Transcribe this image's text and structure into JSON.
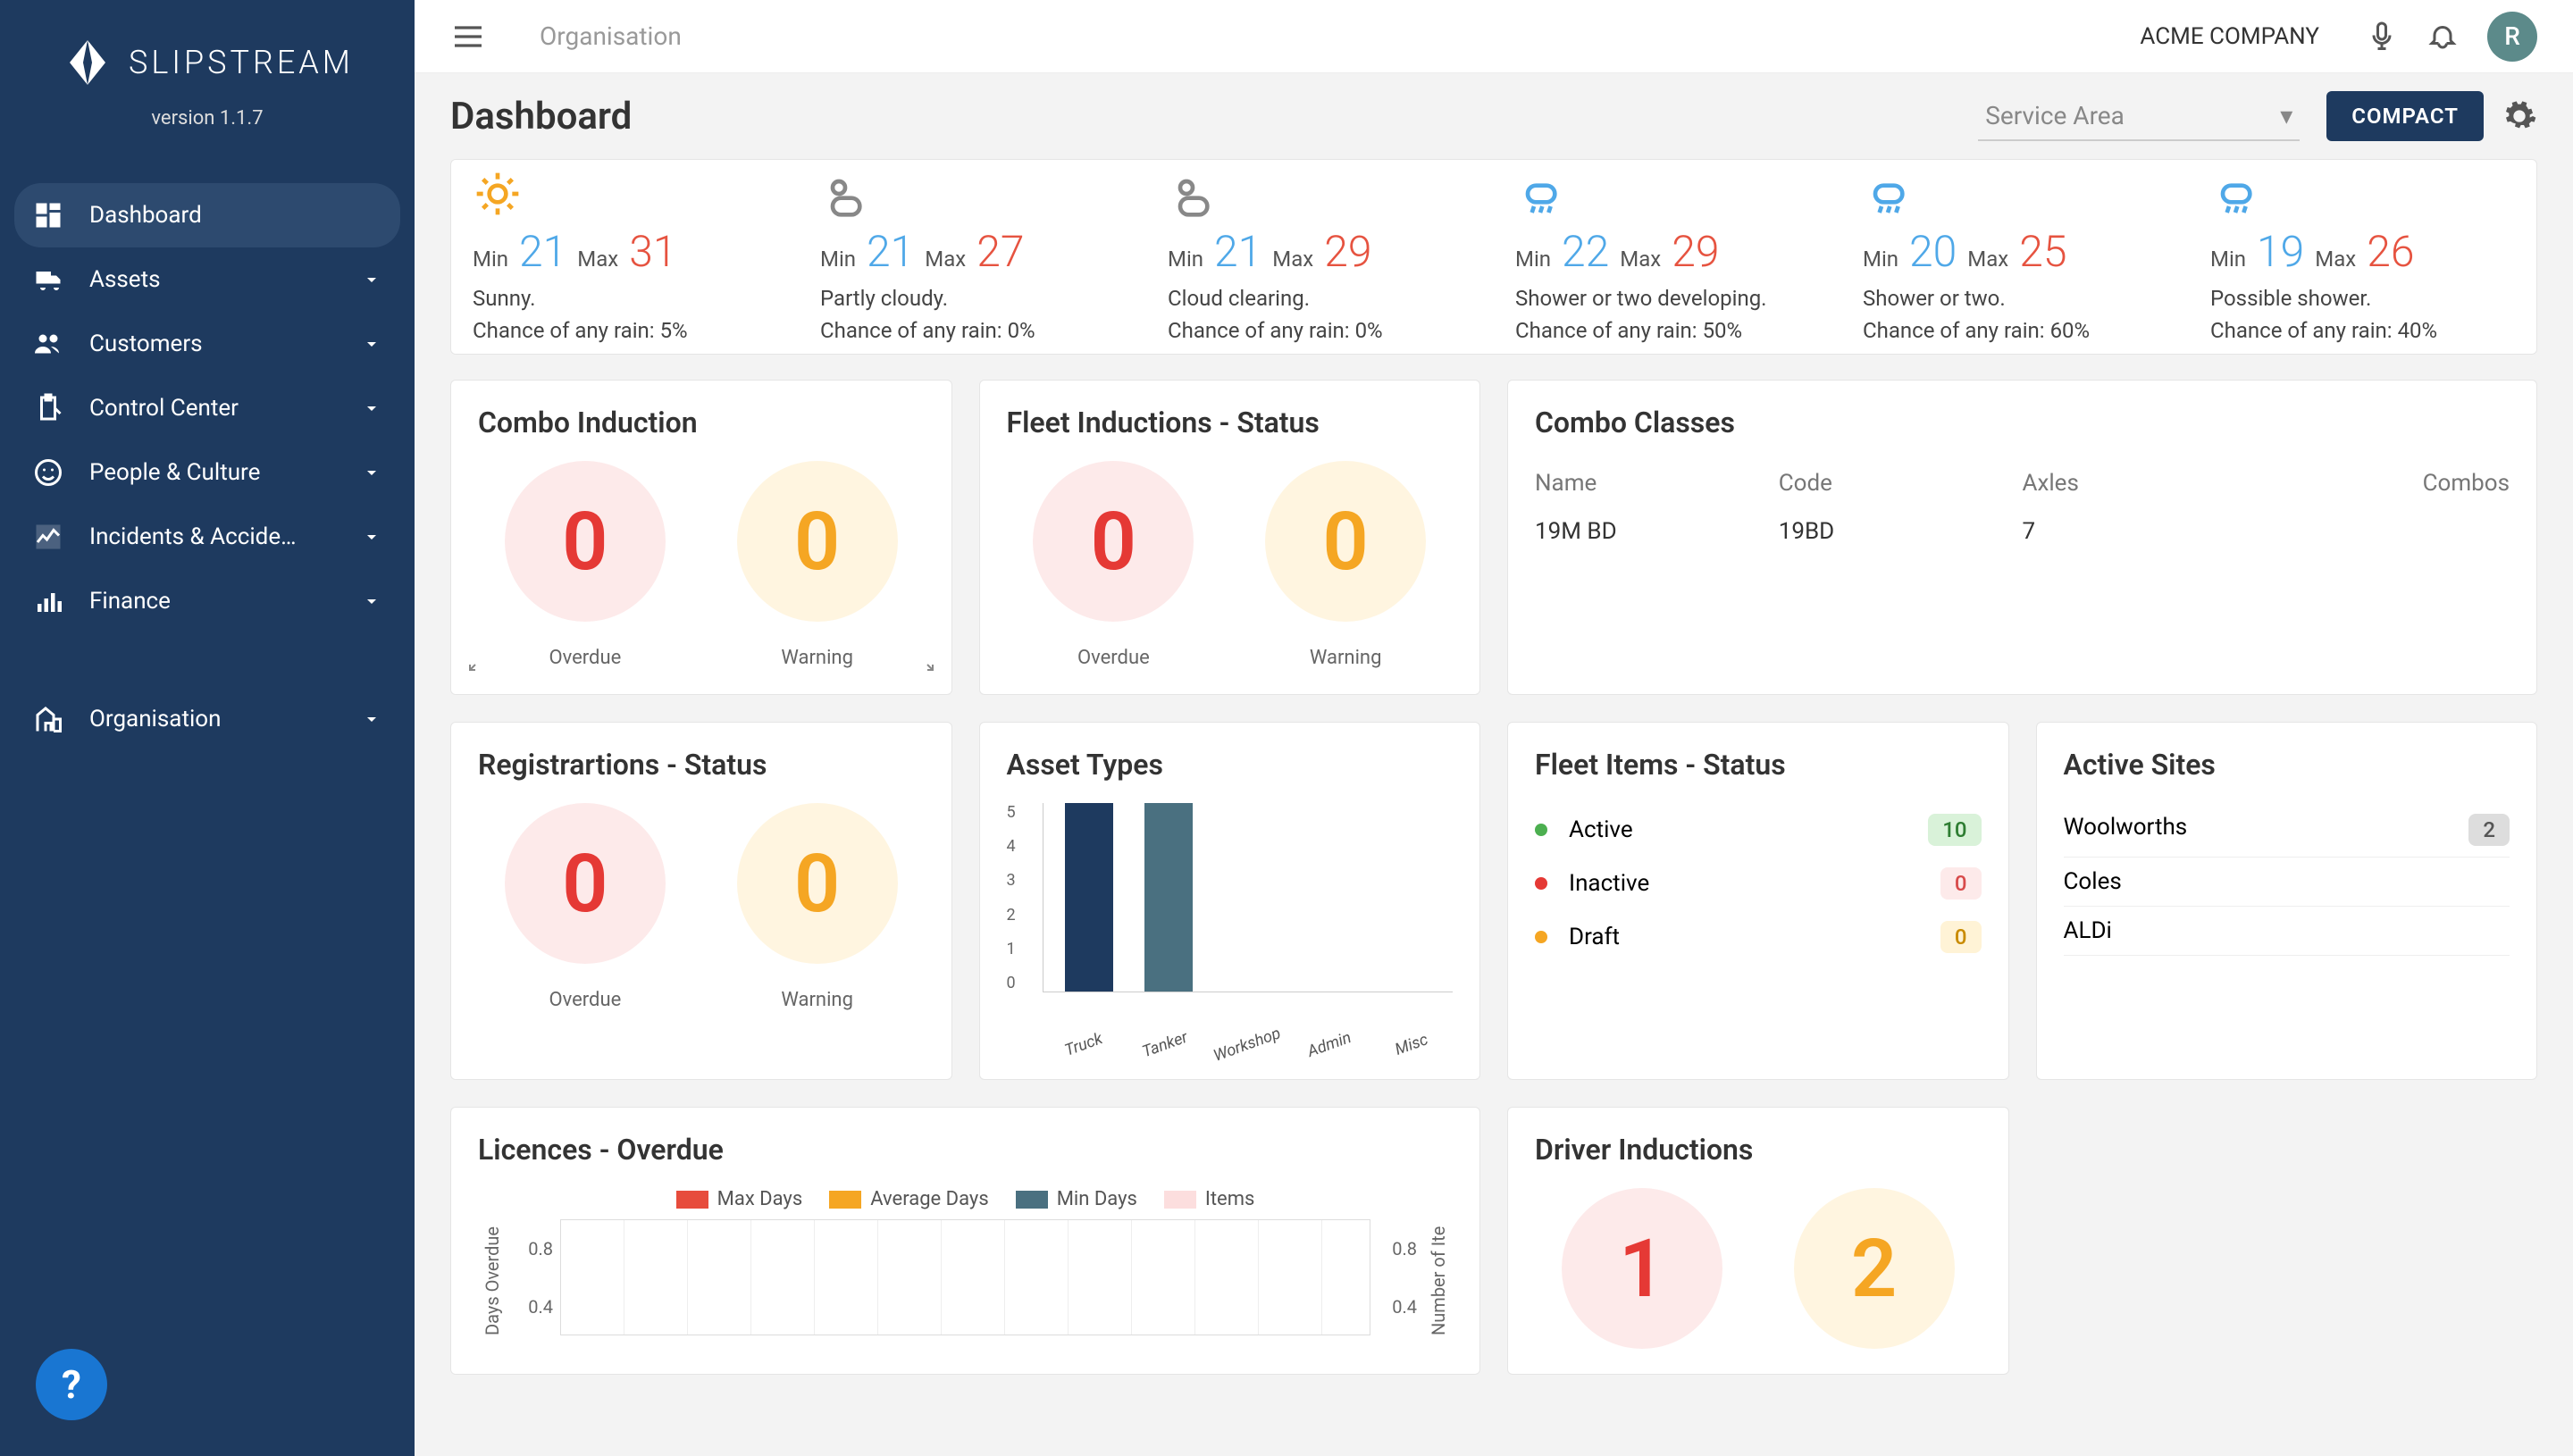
{
  "app": {
    "name": "SLIPSTREAM",
    "version": "version 1.1.7"
  },
  "sidebar": {
    "items": [
      {
        "label": "Dashboard",
        "icon": "dashboard-icon",
        "active": true,
        "expandable": false
      },
      {
        "label": "Assets",
        "icon": "truck-icon",
        "active": false,
        "expandable": true
      },
      {
        "label": "Customers",
        "icon": "people-icon",
        "active": false,
        "expandable": true
      },
      {
        "label": "Control Center",
        "icon": "clipboard-icon",
        "active": false,
        "expandable": true
      },
      {
        "label": "People & Culture",
        "icon": "face-icon",
        "active": false,
        "expandable": true
      },
      {
        "label": "Incidents & Accide…",
        "icon": "chart-broken-icon",
        "active": false,
        "expandable": true
      },
      {
        "label": "Finance",
        "icon": "bars-icon",
        "active": false,
        "expandable": true
      },
      {
        "label": "Organisation",
        "icon": "building-icon",
        "active": false,
        "expandable": true,
        "gap": true
      }
    ]
  },
  "topbar": {
    "breadcrumb": "Organisation",
    "company": "ACME COMPANY",
    "avatar_initial": "R"
  },
  "header": {
    "title": "Dashboard",
    "service_select_placeholder": "Service Area",
    "compact_label": "COMPACT"
  },
  "weather": [
    {
      "icon": "sunny",
      "min": "21",
      "max": "31",
      "desc": "Sunny.",
      "rain": "Chance of any rain: 5%"
    },
    {
      "icon": "partly",
      "min": "21",
      "max": "27",
      "desc": "Partly cloudy.",
      "rain": "Chance of any rain: 0%"
    },
    {
      "icon": "partly",
      "min": "21",
      "max": "29",
      "desc": "Cloud clearing.",
      "rain": "Chance of any rain: 0%"
    },
    {
      "icon": "shower",
      "min": "22",
      "max": "29",
      "desc": "Shower or two developing.",
      "rain": "Chance of any rain: 50%"
    },
    {
      "icon": "shower",
      "min": "20",
      "max": "25",
      "desc": "Shower or two.",
      "rain": "Chance of any rain: 60%"
    },
    {
      "icon": "shower",
      "min": "19",
      "max": "26",
      "desc": "Possible shower.",
      "rain": "Chance of any rain: 40%"
    }
  ],
  "labels": {
    "min": "Min",
    "max": "Max",
    "overdue": "Overdue",
    "warning": "Warning"
  },
  "cards": {
    "combo_induction": {
      "title": "Combo Induction",
      "overdue": "0",
      "warning": "0"
    },
    "fleet_inductions": {
      "title": "Fleet Inductions - Status",
      "overdue": "0",
      "warning": "0"
    },
    "combo_classes": {
      "title": "Combo Classes",
      "columns": [
        "Name",
        "Code",
        "Axles",
        "Combos"
      ],
      "rows": [
        {
          "name": "19M BD",
          "code": "19BD",
          "axles": "7",
          "combos": ""
        }
      ]
    },
    "registrations": {
      "title": "Registrartions - Status",
      "overdue": "0",
      "warning": "0"
    },
    "asset_types": {
      "title": "Asset Types"
    },
    "fleet_items": {
      "title": "Fleet Items - Status",
      "rows": [
        {
          "label": "Active",
          "value": "10",
          "style": "green"
        },
        {
          "label": "Inactive",
          "value": "0",
          "style": "red"
        },
        {
          "label": "Draft",
          "value": "0",
          "style": "amber"
        }
      ]
    },
    "active_sites": {
      "title": "Active Sites",
      "rows": [
        {
          "label": "Woolworths",
          "badge": "2"
        },
        {
          "label": "Coles",
          "badge": ""
        },
        {
          "label": "ALDi",
          "badge": ""
        }
      ]
    },
    "licences": {
      "title": "Licences - Overdue",
      "legend": [
        "Max Days",
        "Average Days",
        "Min Days",
        "Items"
      ],
      "y_left_label": "Days Overdue",
      "y_right_label": "Number of Ite",
      "y_left_ticks": [
        "0.8",
        "0.4"
      ],
      "y_right_ticks": [
        "0.8",
        "0.4"
      ]
    },
    "driver_inductions": {
      "title": "Driver Inductions",
      "overdue": "1",
      "warning": "2"
    }
  },
  "chart_data": {
    "type": "bar",
    "title": "Asset Types",
    "categories": [
      "Truck",
      "Tanker",
      "Workshop",
      "Admin",
      "Misc"
    ],
    "values": [
      5,
      5,
      0,
      0,
      0
    ],
    "ylim": [
      0,
      5
    ],
    "yticks": [
      0,
      1,
      2,
      3,
      4,
      5
    ],
    "xlabel": "",
    "ylabel": ""
  }
}
